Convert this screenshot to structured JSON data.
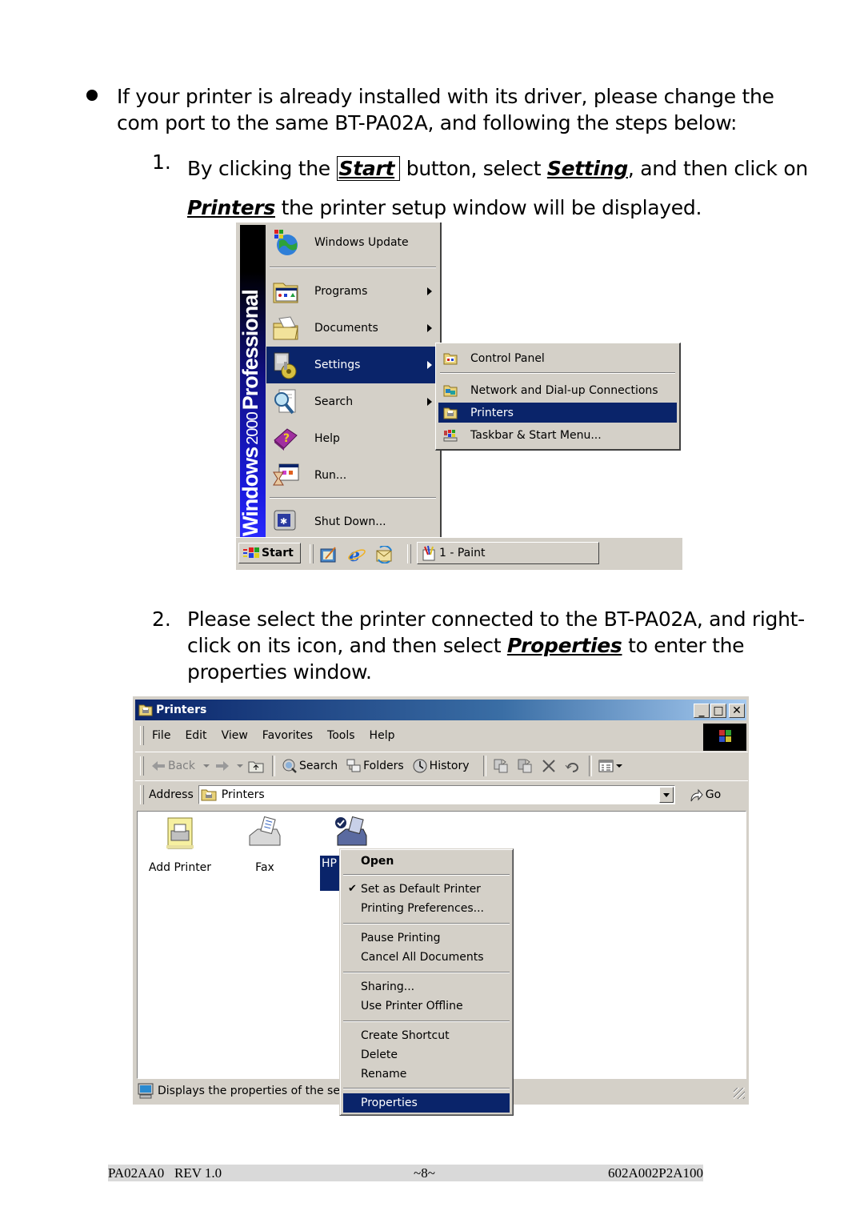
{
  "intro": {
    "text": "If your printer is already installed with its driver, please change the com port to the same BT-PA02A, and following the steps below:"
  },
  "step1": {
    "number": "1.",
    "part1": "By clicking the ",
    "start": "Start",
    "part2": " button, select ",
    "setting": "Setting",
    "part3": ", and then click on ",
    "printers": "Printers",
    "part4": " the printer setup window will be displayed."
  },
  "start_menu": {
    "banner_bold1": "Windows",
    "banner_thin": "2000",
    "banner_bold2": "Professional",
    "items": [
      {
        "label": "Windows Update",
        "icon": "windows-update-icon",
        "submenu": false
      },
      {
        "label": "Programs",
        "icon": "programs-icon",
        "submenu": true
      },
      {
        "label": "Documents",
        "icon": "documents-icon",
        "submenu": true
      },
      {
        "label": "Settings",
        "icon": "settings-icon",
        "submenu": true,
        "selected": true
      },
      {
        "label": "Search",
        "icon": "search-icon",
        "submenu": true
      },
      {
        "label": "Help",
        "icon": "help-icon",
        "submenu": false
      },
      {
        "label": "Run...",
        "icon": "run-icon",
        "submenu": false
      },
      {
        "label": "Shut Down...",
        "icon": "shutdown-icon",
        "submenu": false
      }
    ],
    "settings_submenu": [
      {
        "label": "Control Panel",
        "icon": "control-panel-icon"
      },
      {
        "label": "Network and Dial-up Connections",
        "icon": "network-icon"
      },
      {
        "label": "Printers",
        "icon": "printers-folder-icon",
        "selected": true
      },
      {
        "label": "Taskbar & Start Menu...",
        "icon": "taskbar-icon"
      }
    ]
  },
  "taskbar": {
    "start_label": "Start",
    "quick_launch": [
      "show-desktop-icon",
      "internet-explorer-icon",
      "outlook-express-icon"
    ],
    "task_label": "1 - Paint"
  },
  "step2": {
    "number": "2.",
    "part1": "Please select the printer connected to the BT-PA02A, and right-click on its icon, and then select ",
    "properties": "Properties",
    "part2": " to enter the properties window."
  },
  "printers_window": {
    "title": "Printers",
    "title_buttons": [
      "_",
      "□",
      "✕"
    ],
    "menu": [
      "File",
      "Edit",
      "View",
      "Favorites",
      "Tools",
      "Help"
    ],
    "toolbar": {
      "back": "Back",
      "search": "Search",
      "folders": "Folders",
      "history": "History"
    },
    "address_label": "Address",
    "address_value": "Printers",
    "go_label": "Go",
    "items": [
      {
        "label": "Add Printer",
        "icon": "add-printer-icon"
      },
      {
        "label": "Fax",
        "icon": "fax-icon"
      },
      {
        "label": "HP L",
        "icon": "hp-printer-icon",
        "selected": true
      }
    ],
    "status_text": "Displays the properties of the sel",
    "context_menu": {
      "groups": [
        [
          {
            "label": "Open",
            "bold": true
          }
        ],
        [
          {
            "label": "Set as Default Printer",
            "checked": true
          },
          {
            "label": "Printing Preferences..."
          }
        ],
        [
          {
            "label": "Pause Printing"
          },
          {
            "label": "Cancel All Documents"
          }
        ],
        [
          {
            "label": "Sharing..."
          },
          {
            "label": "Use Printer Offline"
          }
        ],
        [
          {
            "label": "Create Shortcut"
          },
          {
            "label": "Delete"
          },
          {
            "label": "Rename"
          }
        ],
        [
          {
            "label": "Properties",
            "selected": true
          }
        ]
      ],
      "check_glyph": "✔"
    }
  },
  "footer": {
    "left": "PA02AA0   REV 1.0",
    "center": "~8~",
    "right": "602A002P2A100"
  },
  "colors": {
    "selection": "#0a246a",
    "window_face": "#d4d0c8",
    "footer_band": "#d9d9d9"
  }
}
